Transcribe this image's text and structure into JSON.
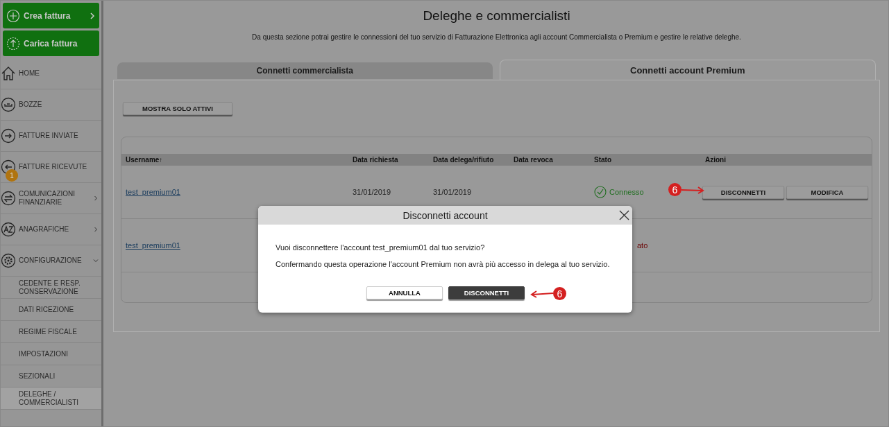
{
  "sidebar": {
    "actions": [
      {
        "label": "Crea fattura",
        "kind": "create"
      },
      {
        "label": "Carica fattura",
        "kind": "upload"
      }
    ],
    "items": [
      {
        "label": "HOME",
        "kind": "home"
      },
      {
        "label": "BOZZE",
        "kind": "drafts"
      },
      {
        "label": "FATTURE INVIATE",
        "kind": "sent"
      },
      {
        "label": "FATTURE RICEVUTE",
        "kind": "received",
        "badge": "1"
      },
      {
        "label": "COMUNICAZIONI FINANZIARIE",
        "kind": "exchange",
        "expanded": false
      },
      {
        "label": "ANAGRAFICHE",
        "kind": "contacts",
        "expanded": false
      },
      {
        "label": "CONFIGURAZIONE",
        "kind": "settings",
        "expanded": true,
        "children": [
          {
            "label": "CEDENTE E RESP. CONSERVAZIONE",
            "selected": false
          },
          {
            "label": "DATI RICEZIONE",
            "selected": false
          },
          {
            "label": "REGIME FISCALE",
            "selected": false
          },
          {
            "label": "IMPOSTAZIONI",
            "selected": false
          },
          {
            "label": "SEZIONALI",
            "selected": false
          },
          {
            "label": "DELEGHE / COMMERCIALISTI",
            "selected": true
          }
        ]
      }
    ]
  },
  "page": {
    "title": "Deleghe e commercialisti",
    "description": "Da questa sezione potrai gestire le connessioni del tuo servizio di Fatturazione Elettronica agli account Commercialista o Premium e gestire le relative deleghe."
  },
  "tabs": [
    {
      "label": "Connetti commercialista",
      "selected": false
    },
    {
      "label": "Connetti account Premium",
      "selected": true
    }
  ],
  "filter_button": "MOSTRA SOLO ATTIVI",
  "table": {
    "columns": [
      {
        "label": "Username",
        "sort": "↑"
      },
      {
        "label": "Data richiesta"
      },
      {
        "label": "Data delega/rifiuto"
      },
      {
        "label": "Data revoca"
      },
      {
        "label": "Stato"
      },
      {
        "label": "Azioni"
      }
    ],
    "rows": [
      {
        "username": "test_premium01",
        "data_richiesta": "31/01/2019",
        "data_delega": "31/01/2019",
        "status": {
          "text": "Connesso",
          "kind": "connected"
        },
        "actions": [
          "DISCONNETTI",
          "MODIFICA"
        ]
      },
      {
        "username": "test_premium01",
        "status": {
          "text": "ato",
          "kind": "revoked"
        },
        "actions": []
      }
    ]
  },
  "dialog": {
    "title": "Disconnetti account",
    "messages": [
      "Vuoi disconnettere l'account test_premium01 dal tuo servizio?",
      "Confermando questa operazione l'account Premium non avrà più accesso in delega al tuo servizio."
    ],
    "buttons": [
      {
        "label": "ANNULLA",
        "kind": "secondary"
      },
      {
        "label": "DISCONNETTI",
        "kind": "primary"
      }
    ]
  },
  "callouts": [
    {
      "label": "6",
      "kind": "pointing-right"
    },
    {
      "label": "6",
      "kind": "pointing-left"
    }
  ]
}
